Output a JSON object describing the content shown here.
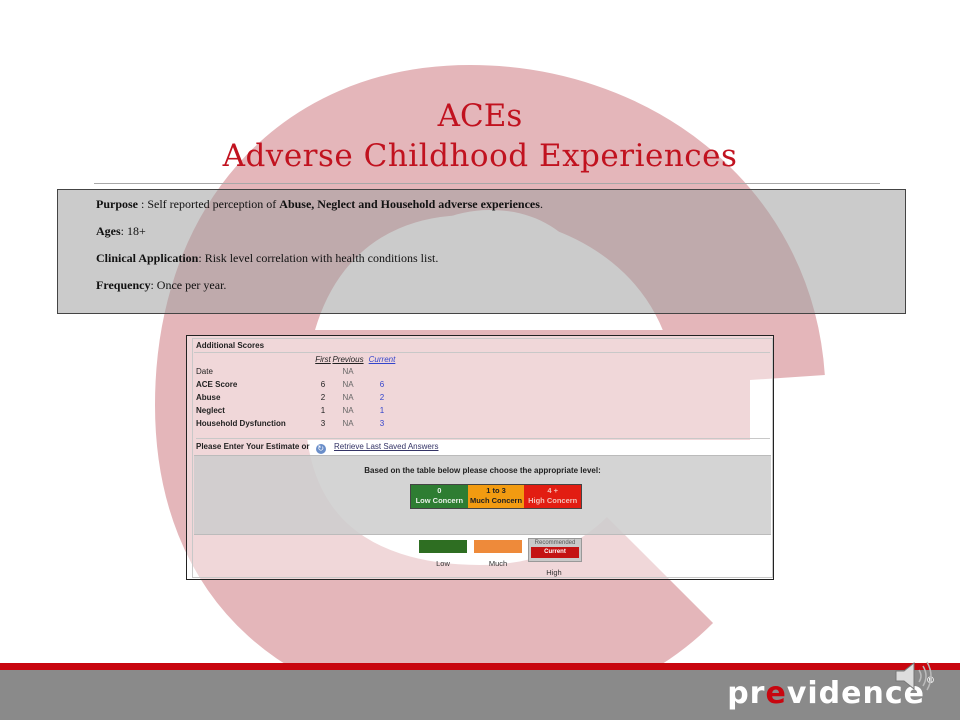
{
  "title": {
    "line1": "ACEs",
    "line2": "Adverse Childhood Experiences"
  },
  "info": {
    "purpose_label": "Purpose",
    "purpose_sep": " : Self reported perception of ",
    "purpose_strong": "Abuse,  Neglect and  Household  adverse  experiences",
    "purpose_end": ".",
    "ages_label": "Ages",
    "ages_value": ": 18+",
    "clinical_label": "Clinical Application",
    "clinical_value": ":   Risk level correlation with health conditions list.",
    "frequency_label": "Frequency",
    "frequency_value": ":  Once per year."
  },
  "scores": {
    "header": "Additional Scores",
    "columns": [
      "First",
      "Previous",
      "Current"
    ],
    "rows": [
      {
        "label": "Date",
        "first": "",
        "previous": "NA",
        "current": ""
      },
      {
        "label": "ACE Score",
        "first": "6",
        "previous": "NA",
        "current": "6"
      },
      {
        "label": "Abuse",
        "first": "2",
        "previous": "NA",
        "current": "2"
      },
      {
        "label": "Neglect",
        "first": "1",
        "previous": "NA",
        "current": "1"
      },
      {
        "label": "Household Dysfunction",
        "first": "3",
        "previous": "NA",
        "current": "3"
      }
    ],
    "estimate_label": "Please Enter Your Estimate or",
    "retrieve_link": "Retrieve Last Saved Answers",
    "instruction": "Based on the table below please choose the appropriate level:",
    "legend": [
      {
        "range": "0",
        "label": "Low Concern"
      },
      {
        "range": "1 to 3",
        "label": "Much Concern"
      },
      {
        "range": "4 +",
        "label": "High Concern"
      }
    ],
    "choices": {
      "low": "Low",
      "much": "Much",
      "high": "High",
      "recommended": "Recommended",
      "current": "Current"
    }
  },
  "footer": {
    "logo_pre": "pr",
    "logo_e": "e",
    "logo_post": "vidence",
    "logo_reg": "®"
  },
  "colors": {
    "title_red": "#c1121f",
    "watermark_red": "#e4b6ba",
    "low_green": "#2e7d32",
    "much_orange": "#f29b11",
    "high_red": "#e21d12",
    "footer_red": "#c8060f",
    "footer_gray": "#8a8a8a"
  }
}
